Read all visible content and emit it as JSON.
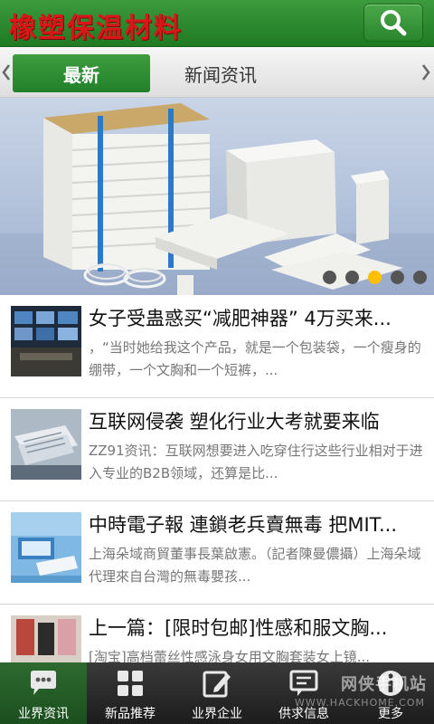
{
  "header": {
    "title": "橡塑保温材料",
    "search_icon": "search-icon"
  },
  "tabs": [
    {
      "label": "最新",
      "active": true
    },
    {
      "label": "新闻资讯",
      "active": false
    }
  ],
  "banner": {
    "slide_count": 5,
    "active_slide": 3
  },
  "news": [
    {
      "title": "女子受蛊惑买“减肥神器” 4万买来...",
      "summary": "，“当时她给我这个产品，就是一个包装袋，一个瘦身的绷带，一个文胸和一个短裤，..."
    },
    {
      "title": "互联网侵袭 塑化行业大考就要来临",
      "summary": "ZZ91资讯：互联网想要进入吃穿住行这些行业相对于进入专业的B2B领域，还算是比..."
    },
    {
      "title": "中時電子報 連鎖老兵賣無毒 把MIT...",
      "summary": "上海朵域商貿董事長葉啟憲。（記者陳曼儂攝）上海朵域代理來自台灣的無毒嬰孩..."
    },
    {
      "title": "上一篇：[限时包邮]性感和服文胸...",
      "summary": "[淘宝]高档蕾丝性感泳身女用文胸套装女上镜..."
    }
  ],
  "bottom_nav": [
    {
      "label": "业界资讯",
      "icon": "chat-bubble-icon",
      "active": true
    },
    {
      "label": "新品推荐",
      "icon": "grid-icon",
      "active": false
    },
    {
      "label": "业界企业",
      "icon": "edit-icon",
      "active": false
    },
    {
      "label": "供求信息",
      "icon": "message-icon",
      "active": false
    },
    {
      "label": "更多",
      "icon": "more-icon",
      "active": false
    }
  ],
  "watermark": {
    "text": "网侠手机站",
    "sub": "WWW.HACKHOME.COM"
  },
  "colors": {
    "brand_green": "#2a852c",
    "title_red": "#d81818",
    "dot_active": "#ffbf00"
  }
}
